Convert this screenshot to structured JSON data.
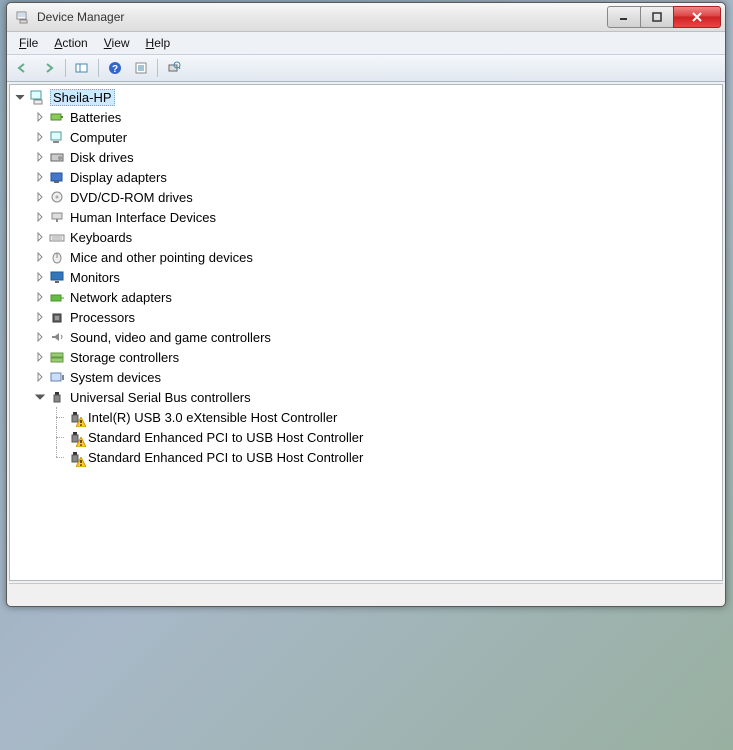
{
  "window": {
    "title": "Device Manager"
  },
  "menu": {
    "file": "File",
    "action": "Action",
    "view": "View",
    "help": "Help"
  },
  "tree": {
    "root": "Sheila-HP",
    "categories": [
      "Batteries",
      "Computer",
      "Disk drives",
      "Display adapters",
      "DVD/CD-ROM drives",
      "Human Interface Devices",
      "Keyboards",
      "Mice and other pointing devices",
      "Monitors",
      "Network adapters",
      "Processors",
      "Sound, video and game controllers",
      "Storage controllers",
      "System devices",
      "Universal Serial Bus controllers"
    ],
    "usb_children": [
      "Intel(R) USB 3.0 eXtensible Host Controller",
      "Standard Enhanced PCI to USB Host Controller",
      "Standard Enhanced PCI to USB Host Controller"
    ]
  }
}
